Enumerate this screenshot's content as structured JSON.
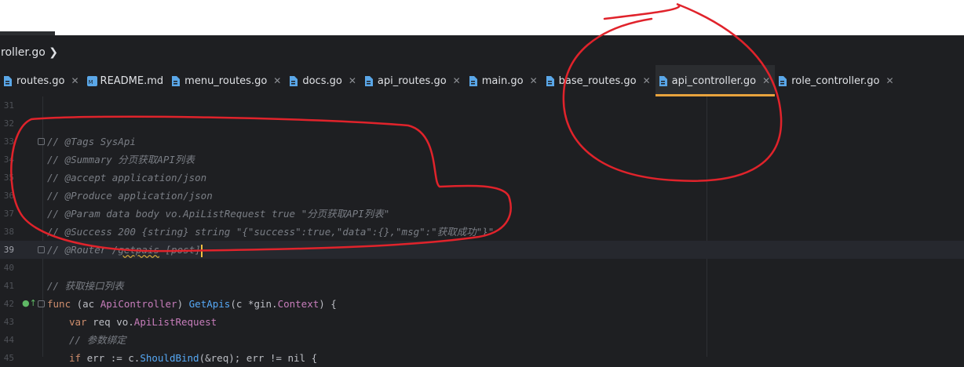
{
  "breadcrumb": {
    "text": "roller.go ❯"
  },
  "tabs": [
    {
      "label": "routes.go",
      "close": "✕",
      "active": false
    },
    {
      "label": "README.md",
      "close": "",
      "active": false
    },
    {
      "label": "menu_routes.go",
      "close": "✕",
      "active": false
    },
    {
      "label": "docs.go",
      "close": "✕",
      "active": false
    },
    {
      "label": "api_routes.go",
      "close": "✕",
      "active": false
    },
    {
      "label": "main.go",
      "close": "✕",
      "active": false
    },
    {
      "label": "base_routes.go",
      "close": "✕",
      "active": false
    },
    {
      "label": "api_controller.go",
      "close": "✕",
      "active": true
    },
    {
      "label": "role_controller.go",
      "close": "✕",
      "active": false
    }
  ],
  "colors": {
    "accent": "#e8a33d",
    "annotation": "#e0232b",
    "background": "#1e1f22"
  },
  "editor": {
    "current_line": 39,
    "lines": [
      {
        "num": "31",
        "text": ""
      },
      {
        "num": "32",
        "text": ""
      },
      {
        "num": "33",
        "text": "// @Tags SysApi"
      },
      {
        "num": "34",
        "text": "// @Summary 分页获取API列表"
      },
      {
        "num": "35",
        "text": "// @accept application/json"
      },
      {
        "num": "36",
        "text": "// @Produce application/json"
      },
      {
        "num": "37",
        "text": "// @Param data body vo.ApiListRequest true \"分页获取API列表\""
      },
      {
        "num": "38",
        "text": "// @Success 200 {string} string \"{\"success\":true,\"data\":{},\"msg\":\"获取成功\"}\""
      },
      {
        "num": "39",
        "text_a": "// @Router /",
        "text_b": "getpais",
        "text_c": " [post]"
      },
      {
        "num": "40",
        "text": ""
      },
      {
        "num": "41",
        "text": "// 获取接口列表"
      },
      {
        "num": "42",
        "kw1": "func",
        "p1": " (ac ",
        "ty1": "ApiController",
        "p2": ") ",
        "fn1": "GetApis",
        "p3": "(c *gin.",
        "ty2": "Context",
        "p4": ") {"
      },
      {
        "num": "43",
        "kw1": "var",
        "p1": " req vo.",
        "ty1": "ApiListRequest"
      },
      {
        "num": "44",
        "text": "// 参数绑定"
      },
      {
        "num": "45",
        "kw1": "if",
        "p1": " err := c.",
        "fn1": "ShouldBind",
        "p2": "(&req); err != nil {"
      }
    ]
  }
}
